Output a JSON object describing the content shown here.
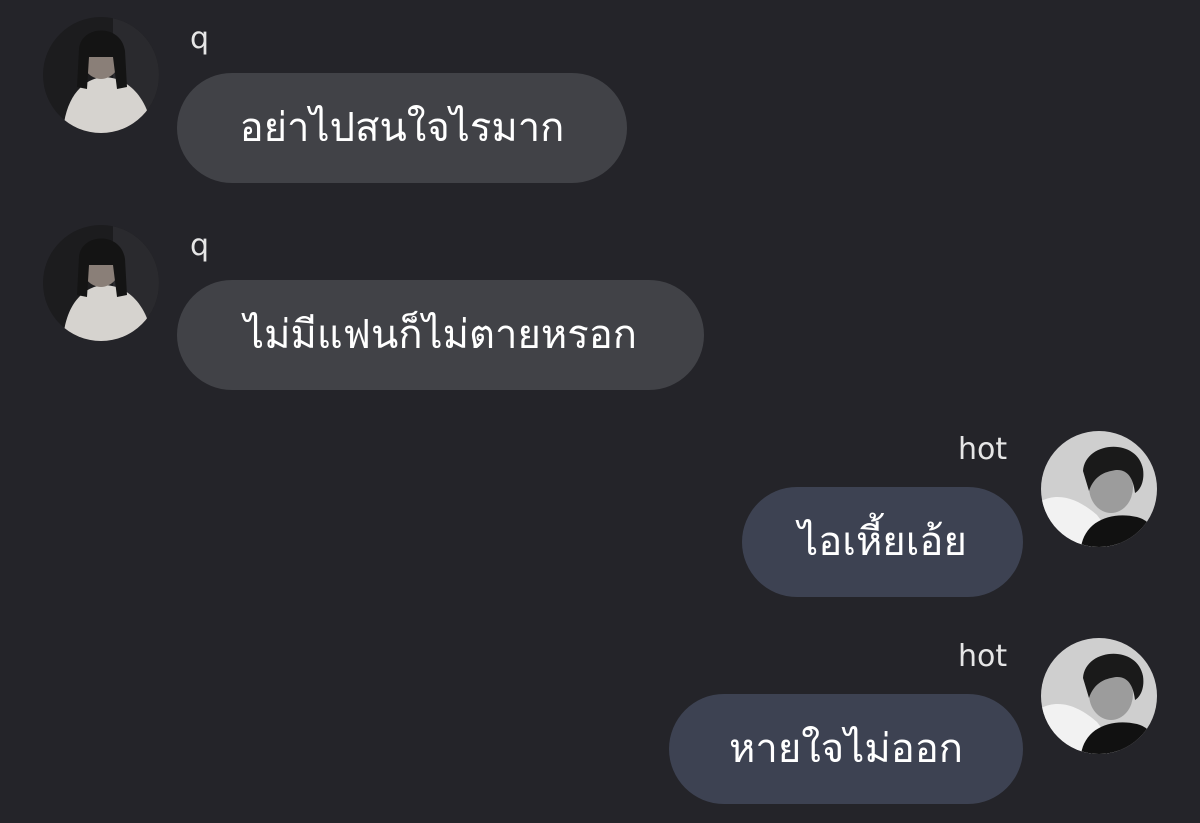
{
  "colors": {
    "background": "#242429",
    "incoming_bubble": "#414247",
    "outgoing_bubble": "#3d4252",
    "text": "#ffffff"
  },
  "messages": [
    {
      "sender": "q",
      "text": "อย่าไปสนใจไรมาก",
      "direction": "incoming",
      "avatar_icon": "user-photo-q-icon"
    },
    {
      "sender": "q",
      "text": "ไม่มีแฟนก็ไม่ตายหรอก",
      "direction": "incoming",
      "avatar_icon": "user-photo-q-icon"
    },
    {
      "sender": "hot",
      "text": "ไอเหี้ยเอ้ย",
      "direction": "outgoing",
      "avatar_icon": "user-photo-hot-icon"
    },
    {
      "sender": "hot",
      "text": "หายใจไม่ออก",
      "direction": "outgoing",
      "avatar_icon": "user-photo-hot-icon"
    }
  ]
}
